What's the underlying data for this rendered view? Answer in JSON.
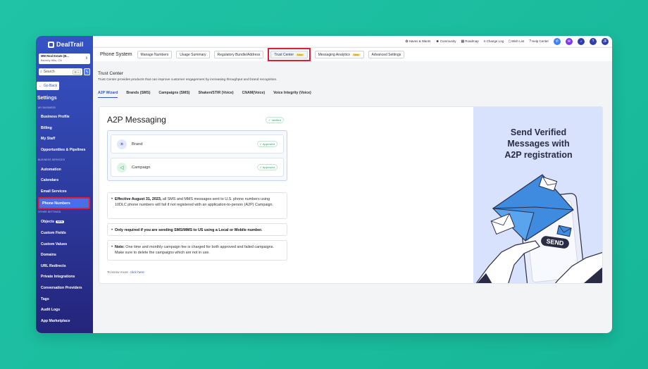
{
  "brand": "DealTrail",
  "account": {
    "name": "MM Real Estate (B...",
    "location": "Beverly Hills, CA"
  },
  "search": {
    "placeholder": "Search",
    "shortcut": "⌘ K"
  },
  "sidebar": {
    "back_label": "Go Back",
    "title": "Settings",
    "sections": {
      "my_business": "MY BUSINESS",
      "business_services": "BUSINESS SERVICES",
      "other_settings": "OTHER SETTINGS"
    },
    "my_business_items": [
      "Business Profile",
      "Billing",
      "My Staff",
      "Opportunities & Pipelines"
    ],
    "business_services_items": [
      "Automation",
      "Calendars",
      "Email Services",
      "Phone Numbers"
    ],
    "other_items": [
      "Objects",
      "Custom Fields",
      "Custom Values",
      "Domains",
      "URL Redirects",
      "Private Integrations",
      "Conversation Providers",
      "Tags",
      "Audit Logs",
      "App Marketplace"
    ],
    "objects_badge": "NEW"
  },
  "topbar": {
    "links": [
      "Haves & Wants",
      "Community",
      "Roadmap",
      "Change Log",
      "Wish List",
      "Help Center"
    ],
    "avatar": "JF"
  },
  "subnav": {
    "title": "Phone System",
    "buttons": [
      "Manage Numbers",
      "Usage Summary",
      "Regulatory Bundle/Address",
      "Trust Center",
      "Messaging Analytics",
      "Advanced Settings"
    ],
    "new_badge": "New"
  },
  "trust_center": {
    "title": "Trust Center",
    "description": "Trust Center provides products that can improve customer engagement by increasing throughput and brand recognition.",
    "tabs": [
      "A2P Wizard",
      "Brands (SMS)",
      "Campaigns (SMS)",
      "Shaken/STIR (Voice)",
      "CNAM(Voice)",
      "Voice Integrity (Voice)"
    ]
  },
  "a2p": {
    "title": "A2P Messaging",
    "verified": "Verified",
    "rows": [
      {
        "label": "Brand",
        "status": "Approved"
      },
      {
        "label": "Campaign",
        "status": "Approved"
      }
    ],
    "note1_bold": "Effective August 31, 2023,",
    "note1_text": "all SMS and MMS messages sent to U.S. phone numbers using 10DLC phone numbers will fail if not registered with an application-to-person (A2P) Campaign.",
    "note2_bold": "Only required if you are sending SMS/MMS to US using a Local or Mobile number.",
    "note3_bold": "Note:",
    "note3_text": "One time and monthly campaign fee is charged for both approved and failed campaigns. Make sure to delete the campaigns which are not in use.",
    "know_more": "To know more",
    "click_here": "click here"
  },
  "illustration": {
    "title_lines": [
      "Send Verified",
      "Messages with",
      "A2P registration"
    ],
    "send_text": "SEND"
  },
  "colors": {
    "accent": "#3553c4",
    "highlight": "#e01e37",
    "approved": "#1fa35a",
    "background": "#1cbfa0"
  }
}
